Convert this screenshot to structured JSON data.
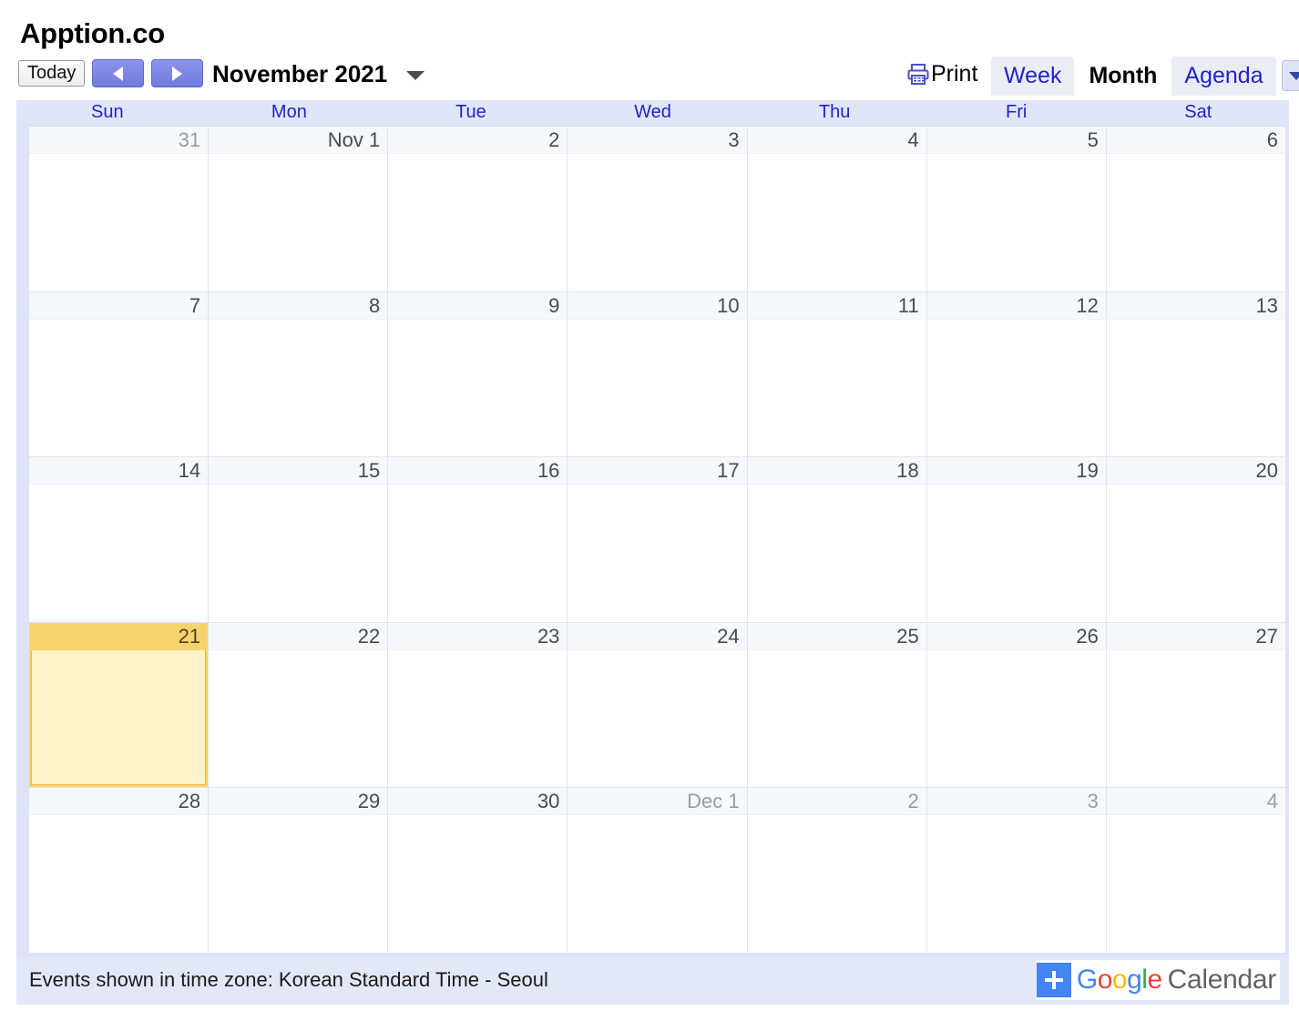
{
  "header": {
    "title": "Apption.co"
  },
  "toolbar": {
    "today_label": "Today",
    "prev_icon": "chevron-left-icon",
    "next_icon": "chevron-right-icon",
    "period_label": "November 2021",
    "period_caret_icon": "chevron-down-icon",
    "print_label": "Print",
    "print_icon": "printer-icon",
    "tabs": [
      {
        "label": "Week",
        "active": false
      },
      {
        "label": "Month",
        "active": true
      },
      {
        "label": "Agenda",
        "active": false
      }
    ],
    "tab_caret_icon": "chevron-down-icon"
  },
  "calendar": {
    "day_names": [
      "Sun",
      "Mon",
      "Tue",
      "Wed",
      "Thu",
      "Fri",
      "Sat"
    ],
    "weeks": [
      [
        {
          "label": "31",
          "other_month": true,
          "today": false
        },
        {
          "label": "Nov 1",
          "other_month": false,
          "today": false
        },
        {
          "label": "2",
          "other_month": false,
          "today": false
        },
        {
          "label": "3",
          "other_month": false,
          "today": false
        },
        {
          "label": "4",
          "other_month": false,
          "today": false
        },
        {
          "label": "5",
          "other_month": false,
          "today": false
        },
        {
          "label": "6",
          "other_month": false,
          "today": false
        }
      ],
      [
        {
          "label": "7",
          "other_month": false,
          "today": false
        },
        {
          "label": "8",
          "other_month": false,
          "today": false
        },
        {
          "label": "9",
          "other_month": false,
          "today": false
        },
        {
          "label": "10",
          "other_month": false,
          "today": false
        },
        {
          "label": "11",
          "other_month": false,
          "today": false
        },
        {
          "label": "12",
          "other_month": false,
          "today": false
        },
        {
          "label": "13",
          "other_month": false,
          "today": false
        }
      ],
      [
        {
          "label": "14",
          "other_month": false,
          "today": false
        },
        {
          "label": "15",
          "other_month": false,
          "today": false
        },
        {
          "label": "16",
          "other_month": false,
          "today": false
        },
        {
          "label": "17",
          "other_month": false,
          "today": false
        },
        {
          "label": "18",
          "other_month": false,
          "today": false
        },
        {
          "label": "19",
          "other_month": false,
          "today": false
        },
        {
          "label": "20",
          "other_month": false,
          "today": false
        }
      ],
      [
        {
          "label": "21",
          "other_month": false,
          "today": true
        },
        {
          "label": "22",
          "other_month": false,
          "today": false
        },
        {
          "label": "23",
          "other_month": false,
          "today": false
        },
        {
          "label": "24",
          "other_month": false,
          "today": false
        },
        {
          "label": "25",
          "other_month": false,
          "today": false
        },
        {
          "label": "26",
          "other_month": false,
          "today": false
        },
        {
          "label": "27",
          "other_month": false,
          "today": false
        }
      ],
      [
        {
          "label": "28",
          "other_month": false,
          "today": false
        },
        {
          "label": "29",
          "other_month": false,
          "today": false
        },
        {
          "label": "30",
          "other_month": false,
          "today": false
        },
        {
          "label": "Dec 1",
          "other_month": true,
          "today": false
        },
        {
          "label": "2",
          "other_month": true,
          "today": false
        },
        {
          "label": "3",
          "other_month": true,
          "today": false
        },
        {
          "label": "4",
          "other_month": true,
          "today": false
        }
      ]
    ]
  },
  "footer": {
    "timezone_note": "Events shown in time zone: Korean Standard Time - Seoul",
    "logo": {
      "plus_icon": "plus-icon",
      "google_letters": [
        "G",
        "o",
        "o",
        "g",
        "l",
        "e"
      ],
      "product": "Calendar"
    }
  },
  "colors": {
    "accent_blue": "#2222cc",
    "nav_button": "#6f7bdf",
    "today_header": "#f7d36d",
    "today_body": "#fdf3c6",
    "today_border": "#e8b93f",
    "header_band": "#e0e5f8",
    "frame": "#dee3f7",
    "footer_band": "#e3e8f9"
  }
}
